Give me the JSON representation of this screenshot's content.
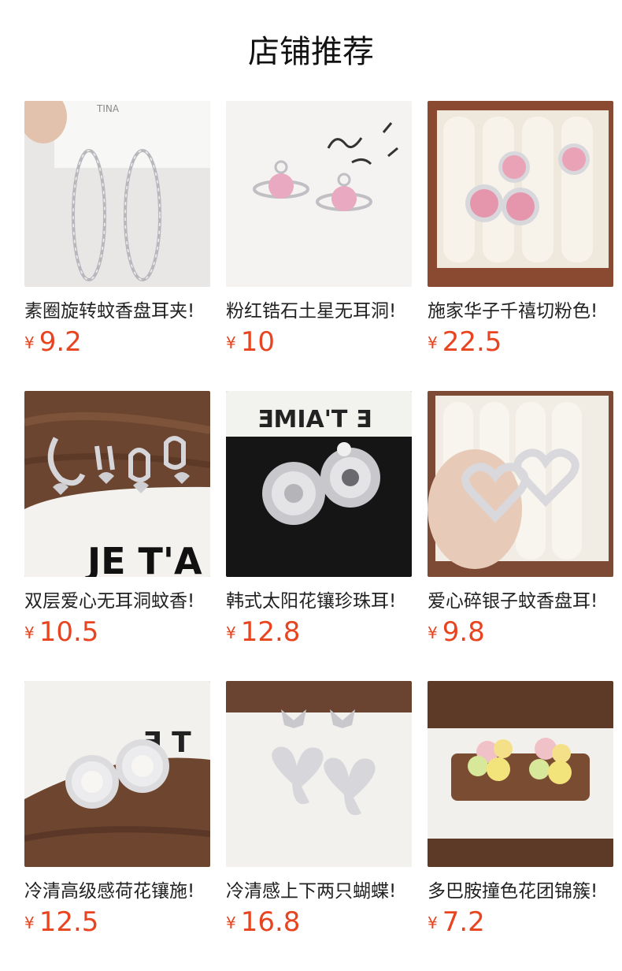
{
  "page": {
    "title": "店铺推荐"
  },
  "products": [
    {
      "name": "素圈旋转蚊香盘耳夹!",
      "currency": "¥",
      "price": "9.2",
      "image": "silver-hoop-earrings"
    },
    {
      "name": "粉红锆石土星无耳洞!",
      "currency": "¥",
      "price": "10",
      "image": "pink-zircon-saturn-earrings"
    },
    {
      "name": "施家华子千禧切粉色!",
      "currency": "¥",
      "price": "22.5",
      "image": "pink-cushion-cut-earrings"
    },
    {
      "name": "双层爱心无耳洞蚊香!",
      "currency": "¥",
      "price": "10.5",
      "image": "double-heart-clip-earrings"
    },
    {
      "name": "韩式太阳花镶珍珠耳!",
      "currency": "¥",
      "price": "12.8",
      "image": "sunflower-pearl-earrings"
    },
    {
      "name": "爱心碎银子蚊香盘耳!",
      "currency": "¥",
      "price": "9.8",
      "image": "silver-heart-earrings"
    },
    {
      "name": "冷清高级感荷花镶施!",
      "currency": "¥",
      "price": "12.5",
      "image": "pearl-lotus-earrings"
    },
    {
      "name": "冷清感上下两只蝴蝶!",
      "currency": "¥",
      "price": "16.8",
      "image": "butterfly-drop-earrings"
    },
    {
      "name": "多巴胺撞色花团锦簇!",
      "currency": "¥",
      "price": "7.2",
      "image": "colorful-flower-earrings"
    }
  ]
}
